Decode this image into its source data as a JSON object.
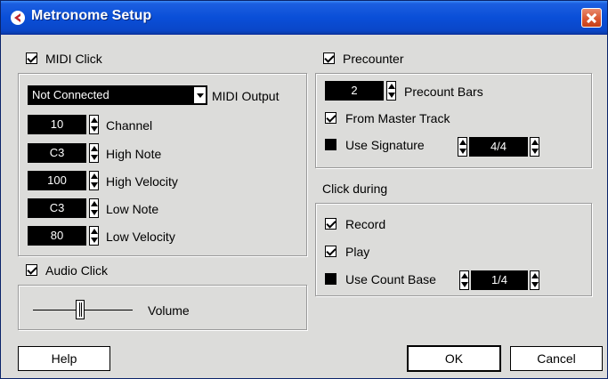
{
  "window": {
    "title": "Metronome Setup",
    "icons": {
      "app": "cubase-logo-icon",
      "close": "close-icon"
    }
  },
  "midi_click": {
    "label": "MIDI Click",
    "checked": true,
    "output": {
      "value": "Not Connected",
      "label": "MIDI Output"
    },
    "fields": [
      {
        "value": "10",
        "label": "Channel"
      },
      {
        "value": "C3",
        "label": "High Note"
      },
      {
        "value": "100",
        "label": "High Velocity"
      },
      {
        "value": "C3",
        "label": "Low Note"
      },
      {
        "value": "80",
        "label": "Low Velocity"
      }
    ]
  },
  "audio_click": {
    "label": "Audio Click",
    "checked": true,
    "volume_label": "Volume"
  },
  "precounter": {
    "label": "Precounter",
    "checked": true,
    "bars": {
      "value": "2",
      "label": "Precount Bars"
    },
    "from_master_track": {
      "label": "From Master Track",
      "checked": true
    },
    "use_signature": {
      "label": "Use Signature",
      "checked": false,
      "value": "4/4"
    }
  },
  "click_during": {
    "label": "Click during",
    "record": {
      "label": "Record",
      "checked": true
    },
    "play": {
      "label": "Play",
      "checked": true
    },
    "use_count_base": {
      "label": "Use Count Base",
      "checked": false,
      "value": "1/4"
    }
  },
  "buttons": {
    "help": "Help",
    "ok": "OK",
    "cancel": "Cancel"
  },
  "colors": {
    "title_bar": "#0a4fd8",
    "dialog_bg": "#dcdcda",
    "field_bg": "#000000",
    "field_text": "#ffffff",
    "close": "#d9532d"
  }
}
